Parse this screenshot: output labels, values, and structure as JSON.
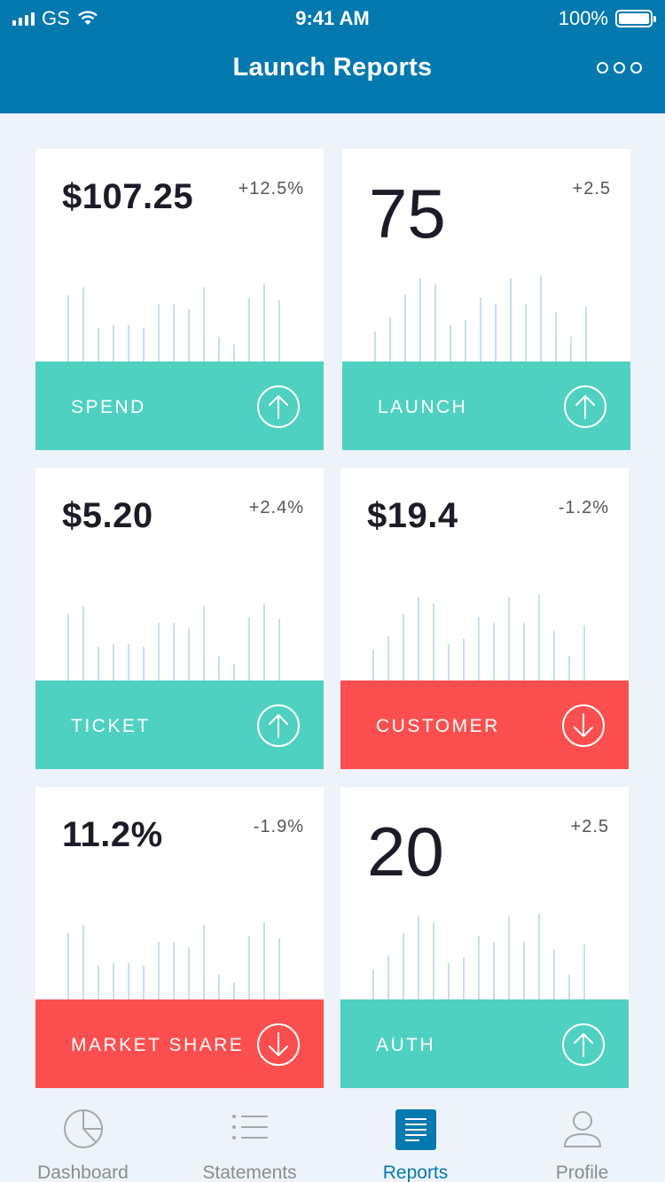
{
  "status": {
    "carrier": "GS",
    "time": "9:41 AM",
    "battery": "100%"
  },
  "header": {
    "title": "Launch Reports",
    "more_icon": "more-horizontal-icon"
  },
  "cards": [
    {
      "value": "$107.25",
      "delta": "+12.5%",
      "label": "SPEND",
      "trend": "up",
      "bars": [
        0.75,
        0.84,
        0.38,
        0.41,
        0.41,
        0.38,
        0.65,
        0.65,
        0.59,
        0.84,
        0.28,
        0.19,
        0.72,
        0.87,
        0.69
      ]
    },
    {
      "value": "75",
      "delta": "+2.5",
      "label": "LAUNCH",
      "trend": "up",
      "bars": [
        0.34,
        0.5,
        0.75,
        0.94,
        0.87,
        0.41,
        0.47,
        0.72,
        0.65,
        0.94,
        0.65,
        0.97,
        0.56,
        0.28,
        0.62
      ]
    },
    {
      "value": "$5.20",
      "delta": "+2.4%",
      "label": "TICKET",
      "trend": "up",
      "bars": [
        0.75,
        0.84,
        0.38,
        0.41,
        0.41,
        0.38,
        0.65,
        0.65,
        0.59,
        0.84,
        0.28,
        0.19,
        0.72,
        0.87,
        0.69
      ]
    },
    {
      "value": "$19.4",
      "delta": "-1.2%",
      "label": "CUSTOMER",
      "trend": "down",
      "bars": [
        0.34,
        0.5,
        0.75,
        0.94,
        0.87,
        0.41,
        0.47,
        0.72,
        0.65,
        0.94,
        0.65,
        0.97,
        0.56,
        0.28,
        0.62
      ]
    },
    {
      "value": "11.2%",
      "delta": "-1.9%",
      "label": "MARKET SHARE",
      "trend": "down",
      "bars": [
        0.75,
        0.84,
        0.38,
        0.41,
        0.41,
        0.38,
        0.65,
        0.65,
        0.59,
        0.84,
        0.28,
        0.19,
        0.72,
        0.87,
        0.69
      ]
    },
    {
      "value": "20",
      "delta": "+2.5",
      "label": "AUTH",
      "trend": "up",
      "bars": [
        0.34,
        0.5,
        0.75,
        0.94,
        0.87,
        0.41,
        0.47,
        0.72,
        0.65,
        0.94,
        0.65,
        0.97,
        0.56,
        0.28,
        0.62
      ]
    }
  ],
  "tabs": [
    {
      "label": "Dashboard",
      "icon": "pie-chart-icon",
      "active": false
    },
    {
      "label": "Statements",
      "icon": "list-icon",
      "active": false
    },
    {
      "label": "Reports",
      "icon": "document-icon",
      "active": true
    },
    {
      "label": "Profile",
      "icon": "user-icon",
      "active": false
    }
  ],
  "colors": {
    "primary": "#0479af",
    "up": "#4fd1c1",
    "down": "#fb4f4f",
    "background": "#edf3f9",
    "bar": "#c6e1e8"
  }
}
